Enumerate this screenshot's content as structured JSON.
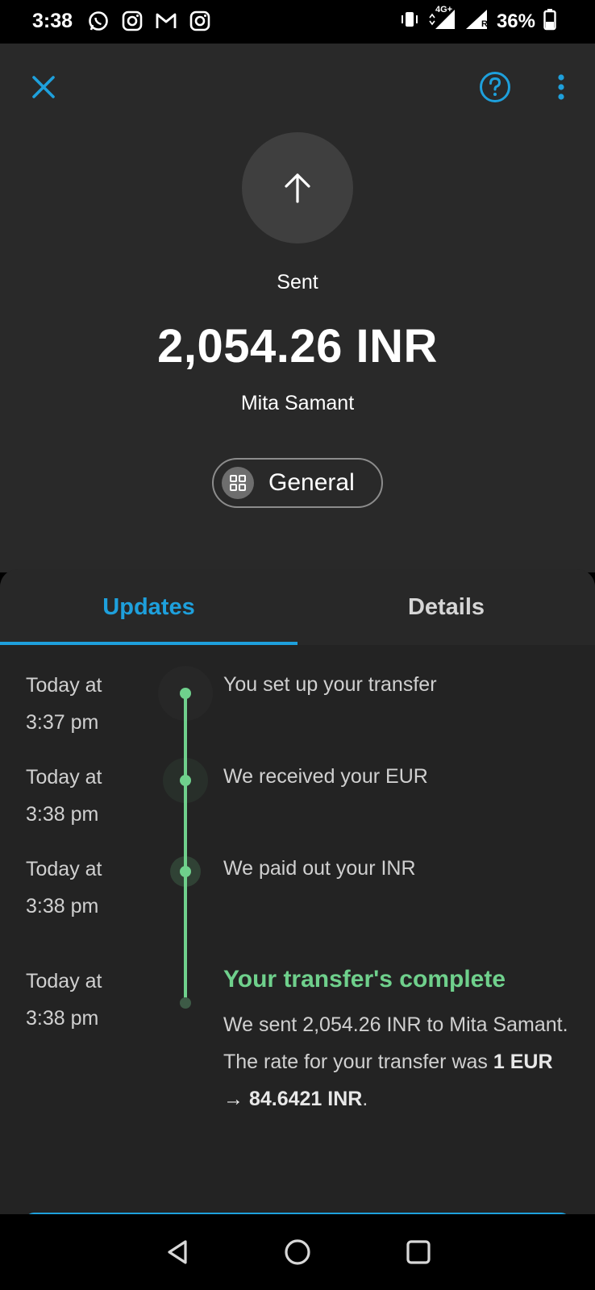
{
  "status_bar": {
    "time": "3:38",
    "network": "4G+",
    "roaming": "R",
    "battery": "36%",
    "left_icons": [
      "whatsapp-icon",
      "instagram-icon",
      "gmail-icon",
      "instagram-icon"
    ]
  },
  "header": {
    "status": "Sent",
    "amount": "2,054.26 INR",
    "recipient": "Mita Samant",
    "category": "General"
  },
  "tabs": [
    {
      "label": "Updates",
      "active": true
    },
    {
      "label": "Details",
      "active": false
    }
  ],
  "timeline": [
    {
      "date_line1": "Today at",
      "date_line2": "3:37 pm",
      "text": "You set up your transfer"
    },
    {
      "date_line1": "Today at",
      "date_line2": "3:38 pm",
      "text": "We received your EUR"
    },
    {
      "date_line1": "Today at",
      "date_line2": "3:38 pm",
      "text": "We paid out your INR"
    },
    {
      "date_line1": "Today at",
      "date_line2": "3:38 pm",
      "title": "Your transfer's complete",
      "desc_prefix": "We sent 2,054.26 INR to Mita Samant. The rate for your transfer was ",
      "rate": "1 EUR → 84.6421 INR",
      "desc_suffix": "."
    }
  ],
  "colors": {
    "accent": "#1ea0dc",
    "success": "#6fd08c",
    "header_bg": "#292929",
    "panel_bg": "#232323"
  }
}
